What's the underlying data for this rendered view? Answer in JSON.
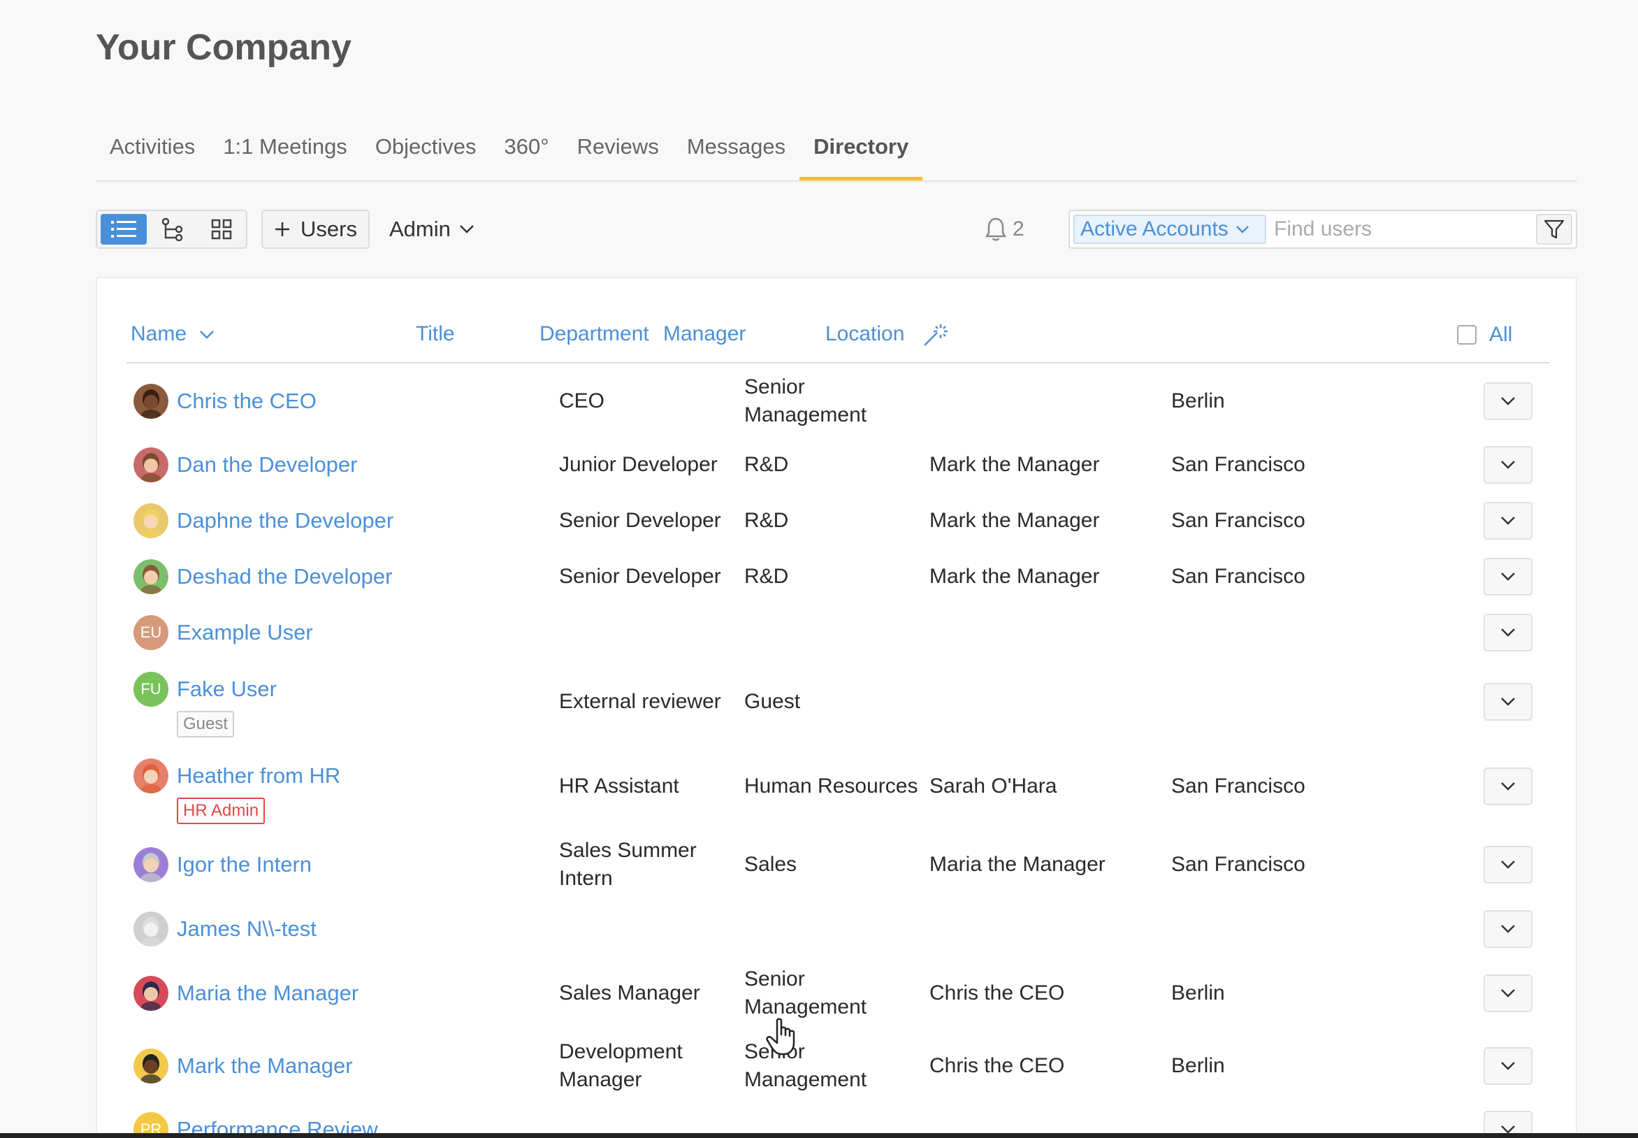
{
  "company": {
    "title": "Your Company"
  },
  "tabs": [
    {
      "label": "Activities",
      "active": false
    },
    {
      "label": "1:1 Meetings",
      "active": false
    },
    {
      "label": "Objectives",
      "active": false
    },
    {
      "label": "360°",
      "active": false
    },
    {
      "label": "Reviews",
      "active": false
    },
    {
      "label": "Messages",
      "active": false
    },
    {
      "label": "Directory",
      "active": true
    }
  ],
  "toolbar": {
    "add_users_label": "Users",
    "admin_label": "Admin",
    "notification_count": "2",
    "account_filter": "Active Accounts",
    "search_placeholder": "Find users"
  },
  "table": {
    "headers": {
      "name": "Name",
      "title": "Title",
      "department": "Department",
      "manager": "Manager",
      "location": "Location",
      "all": "All"
    },
    "rows": [
      {
        "name": "Chris the CEO",
        "title": "CEO",
        "department": "Senior\nManagement",
        "manager": "",
        "location": "Berlin",
        "badge": ""
      },
      {
        "name": "Dan the Developer",
        "title": "Junior Developer",
        "department": "R&D",
        "manager": "Mark the Manager",
        "location": "San Francisco",
        "badge": ""
      },
      {
        "name": "Daphne the Developer",
        "title": "Senior Developer",
        "department": "R&D",
        "manager": "Mark the Manager",
        "location": "San Francisco",
        "badge": ""
      },
      {
        "name": "Deshad the Developer",
        "title": "Senior Developer",
        "department": "R&D",
        "manager": "Mark the Manager",
        "location": "San Francisco",
        "badge": ""
      },
      {
        "name": "Example User",
        "initials": "EU",
        "title": "",
        "department": "",
        "manager": "",
        "location": "",
        "badge": ""
      },
      {
        "name": "Fake User",
        "initials": "FU",
        "title": "External reviewer",
        "department": "Guest",
        "manager": "",
        "location": "",
        "badge": "Guest"
      },
      {
        "name": "Heather from HR",
        "title": "HR Assistant",
        "department": "Human Resources",
        "manager": "Sarah O'Hara",
        "location": "San Francisco",
        "badge": "HR Admin"
      },
      {
        "name": "Igor the Intern",
        "title": "Sales Summer\nIntern",
        "department": "Sales",
        "manager": "Maria the Manager",
        "location": "San Francisco",
        "badge": ""
      },
      {
        "name": "James N\\\\-test",
        "title": "",
        "department": "",
        "manager": "",
        "location": "",
        "badge": ""
      },
      {
        "name": "Maria the Manager",
        "title": "Sales Manager",
        "department": "Senior\nManagement",
        "manager": "Chris the CEO",
        "location": "Berlin",
        "badge": ""
      },
      {
        "name": "Mark the Manager",
        "title": "Development\nManager",
        "department": "Senior\nManagement",
        "manager": "Chris the CEO",
        "location": "Berlin",
        "badge": ""
      },
      {
        "name": "Performance Review",
        "initials": "PR",
        "title": "",
        "department": "",
        "manager": "",
        "location": "",
        "badge": ""
      }
    ]
  },
  "colors": {
    "accent": "#4a90d9",
    "tab_underline": "#f2c12e",
    "hr_badge": "#e04848",
    "avatar_colors": [
      "#8b5a3c",
      "#c96a6a",
      "#e9c96a",
      "#7cbf6a",
      "#d69a7a",
      "#7ac25b",
      "#e5806b",
      "#9b7ed6",
      "#cfcfcf",
      "#d84a5a",
      "#f2c94c",
      "#f5c842"
    ]
  },
  "icons": {
    "view_list": "list-icon",
    "view_tree": "org-tree-icon",
    "view_grid": "grid-icon",
    "add": "plus-icon",
    "notifications": "bell-icon",
    "filter": "funnel-icon",
    "location_magic": "magic-wand-icon",
    "row_menu": "chevron-down-icon"
  }
}
